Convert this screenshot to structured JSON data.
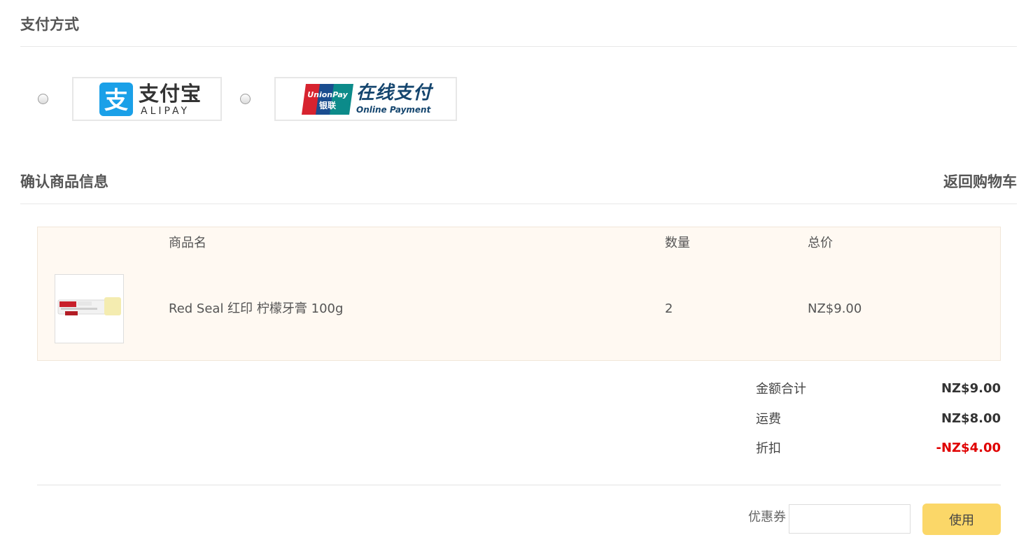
{
  "payment": {
    "title": "支付方式",
    "options": [
      {
        "id": "alipay",
        "logo_cn": "支付宝",
        "logo_en": "ALIPAY",
        "brand_color": "#1aa0e8",
        "icon": "alipay-logo-icon"
      },
      {
        "id": "unionpay",
        "logo_mark_top": "UnionPay",
        "logo_mark_bottom": "银联",
        "logo_cn": "在线支付",
        "logo_en": "Online Payment",
        "brand_color": "#14456e",
        "icon": "unionpay-logo-icon"
      }
    ]
  },
  "confirm": {
    "title": "确认商品信息",
    "back_to_cart": "返回购物车"
  },
  "table": {
    "headers": {
      "name": "商品名",
      "quantity": "数量",
      "total": "总价"
    },
    "rows": [
      {
        "image": "toothpaste-product-image",
        "name": "Red Seal 红印 柠檬牙膏 100g",
        "quantity": "2",
        "total": "NZ$9.00"
      }
    ]
  },
  "summary": {
    "subtotal_label": "金额合计",
    "subtotal_value": "NZ$9.00",
    "shipping_label": "运费",
    "shipping_value": "NZ$8.00",
    "discount_label": "折扣",
    "discount_value": "-NZ$4.00"
  },
  "coupon": {
    "label": "优惠券",
    "value": "",
    "button": "使用"
  },
  "colors": {
    "table_bg": "#fff9f2",
    "discount": "#e00000",
    "button": "#fbd768"
  }
}
